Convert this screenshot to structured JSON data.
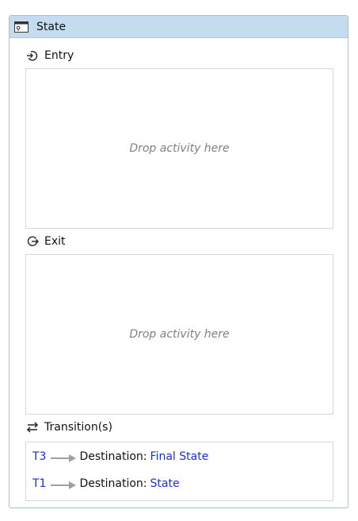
{
  "state": {
    "title": "State",
    "entry": {
      "label": "Entry",
      "placeholder": "Drop activity here"
    },
    "exit": {
      "label": "Exit",
      "placeholder": "Drop activity here"
    },
    "transitions": {
      "label": "Transition(s)",
      "destination_label": "Destination:",
      "items": [
        {
          "name": "T3",
          "destination": "Final State"
        },
        {
          "name": "T1",
          "destination": "State"
        }
      ]
    }
  },
  "colors": {
    "header_bg": "#c4dcee",
    "border": "#9ec3dd",
    "link": "#1a2fd6",
    "placeholder": "#808080"
  },
  "icons": {
    "header": "state-icon",
    "entry": "entry-icon",
    "exit": "exit-icon",
    "transitions": "transitions-icon",
    "transition_arrow": "arrow-right-icon"
  }
}
